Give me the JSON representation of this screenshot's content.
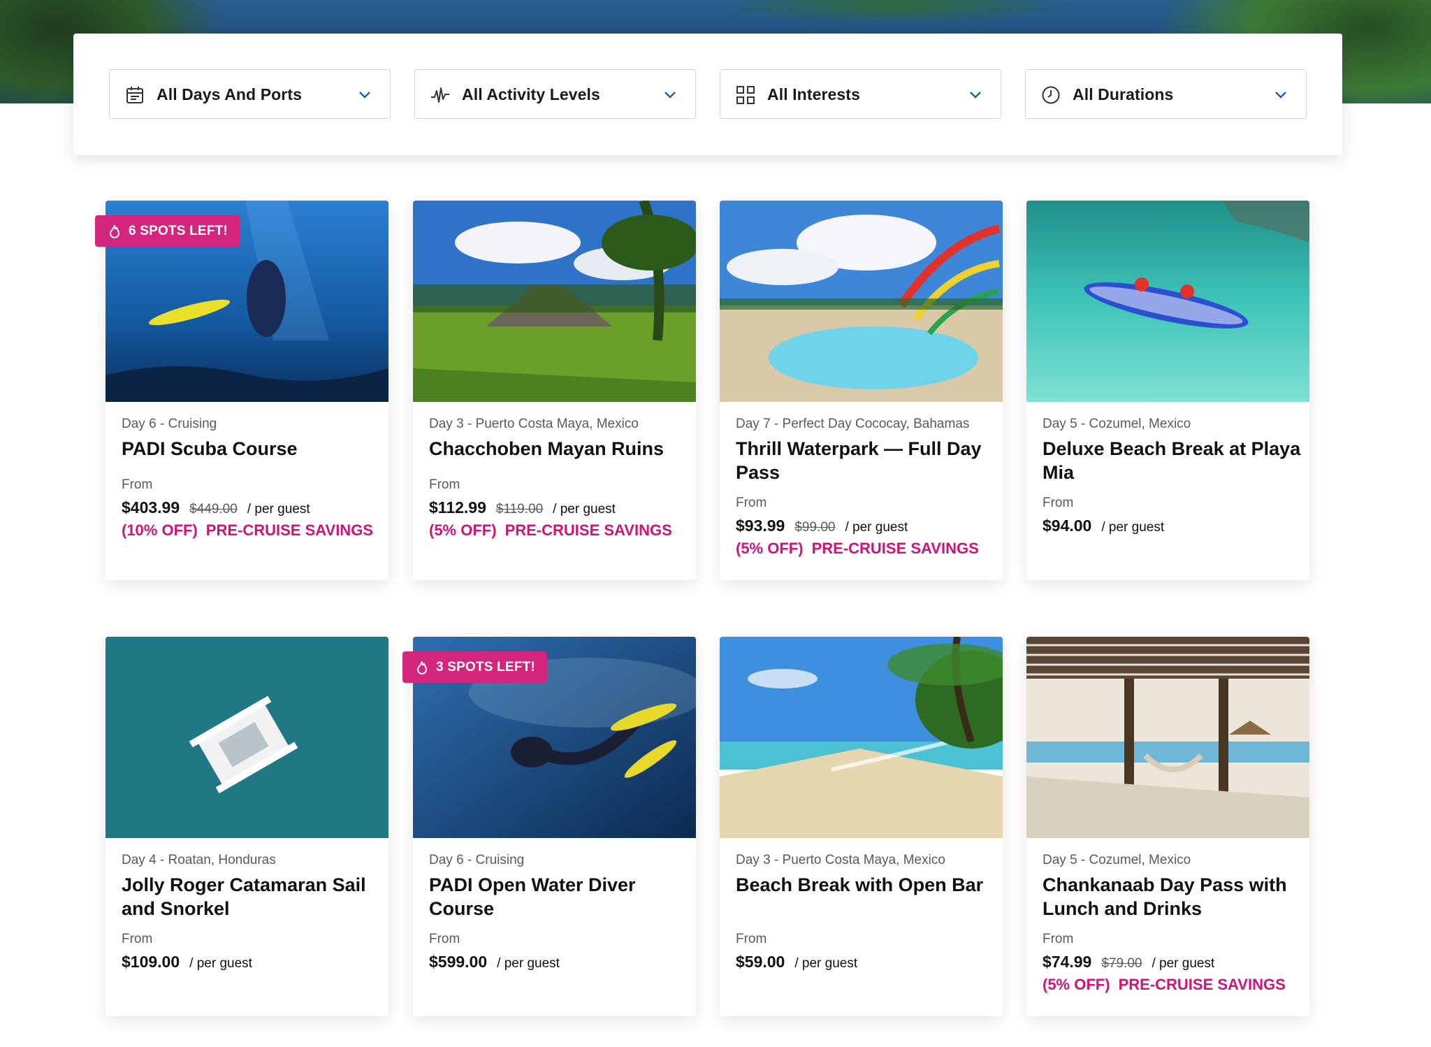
{
  "filters": [
    {
      "label": "All Days And Ports",
      "icon": "calendar-icon"
    },
    {
      "label": "All Activity Levels",
      "icon": "activity-icon"
    },
    {
      "label": "All Interests",
      "icon": "grid-icon"
    },
    {
      "label": "All Durations",
      "icon": "clock-icon"
    }
  ],
  "cards": [
    {
      "meta": "Day 6 - Cruising",
      "title": "PADI Scuba Course",
      "from": "From",
      "price": "$403.99",
      "original": "$449.00",
      "per": "/ per guest",
      "discount": "(10% OFF)",
      "savings": "PRE-CRUISE SAVINGS",
      "badge": "6 SPOTS LEFT!"
    },
    {
      "meta": "Day 3 - Puerto Costa Maya, Mexico",
      "title": "Chacchoben Mayan Ruins",
      "from": "From",
      "price": "$112.99",
      "original": "$119.00",
      "per": "/ per guest",
      "discount": "(5% OFF)",
      "savings": "PRE-CRUISE SAVINGS"
    },
    {
      "meta": "Day 7 - Perfect Day Cococay, Bahamas",
      "title": "Thrill Waterpark — Full Day Pass",
      "from": "From",
      "price": "$93.99",
      "original": "$99.00",
      "per": "/ per guest",
      "discount": "(5% OFF)",
      "savings": "PRE-CRUISE SAVINGS"
    },
    {
      "meta": "Day 5 - Cozumel, Mexico",
      "title": "Deluxe Beach Break at Playa Mia",
      "from": "From",
      "price": "$94.00",
      "per": "/ per guest"
    },
    {
      "meta": "Day 4 - Roatan, Honduras",
      "title": "Jolly Roger Catamaran Sail and Snorkel",
      "from": "From",
      "price": "$109.00",
      "per": "/ per guest"
    },
    {
      "meta": "Day 6 - Cruising",
      "title": "PADI Open Water Diver Course",
      "from": "From",
      "price": "$599.00",
      "per": "/ per guest",
      "badge": "3 SPOTS LEFT!"
    },
    {
      "meta": "Day 3 - Puerto Costa Maya, Mexico",
      "title": "Beach Break with Open Bar",
      "from": "From",
      "price": "$59.00",
      "per": "/ per guest"
    },
    {
      "meta": "Day 5 - Cozumel, Mexico",
      "title": "Chankanaab Day Pass with Lunch and Drinks",
      "from": "From",
      "price": "$74.99",
      "original": "$79.00",
      "per": "/ per guest",
      "discount": "(5% OFF)",
      "savings": "PRE-CRUISE SAVINGS"
    }
  ],
  "colors": {
    "accent": "#d1127a",
    "badge": "#d4257d",
    "chevron": "#1f5fa8"
  }
}
